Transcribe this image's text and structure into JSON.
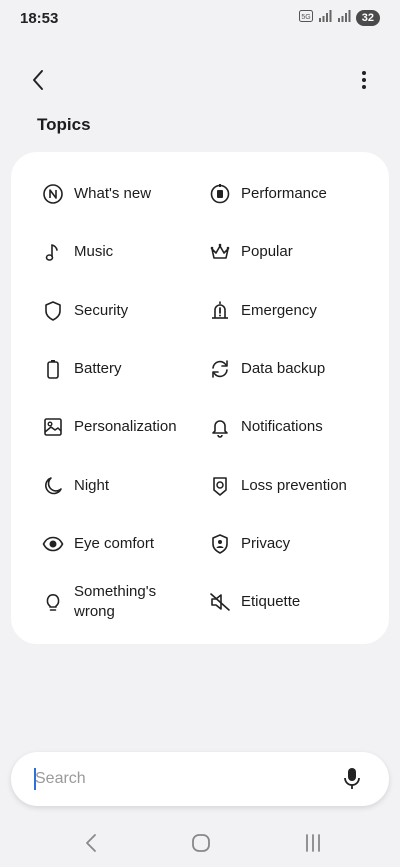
{
  "status_bar": {
    "time": "18:53",
    "battery": "32"
  },
  "header": {
    "title": "Topics"
  },
  "topics": [
    {
      "label": "What's new",
      "icon": "n-circle-icon"
    },
    {
      "label": "Performance",
      "icon": "performance-icon"
    },
    {
      "label": "Music",
      "icon": "music-note-icon"
    },
    {
      "label": "Popular",
      "icon": "crown-icon"
    },
    {
      "label": "Security",
      "icon": "shield-icon"
    },
    {
      "label": "Emergency",
      "icon": "emergency-icon"
    },
    {
      "label": "Battery",
      "icon": "battery-icon"
    },
    {
      "label": "Data backup",
      "icon": "sync-icon"
    },
    {
      "label": "Personalization",
      "icon": "image-icon"
    },
    {
      "label": "Notifications",
      "icon": "bell-icon"
    },
    {
      "label": "Night",
      "icon": "moon-icon"
    },
    {
      "label": "Loss prevention",
      "icon": "loss-prevention-icon"
    },
    {
      "label": "Eye comfort",
      "icon": "eye-icon"
    },
    {
      "label": "Privacy",
      "icon": "privacy-shield-icon"
    },
    {
      "label": "Something's wrong",
      "icon": "lightbulb-icon"
    },
    {
      "label": "Etiquette",
      "icon": "mute-icon"
    }
  ],
  "search": {
    "placeholder": "Search",
    "value": ""
  },
  "colors": {
    "background": "#f2f2f4",
    "card": "#ffffff",
    "caret": "#2e72d8"
  }
}
